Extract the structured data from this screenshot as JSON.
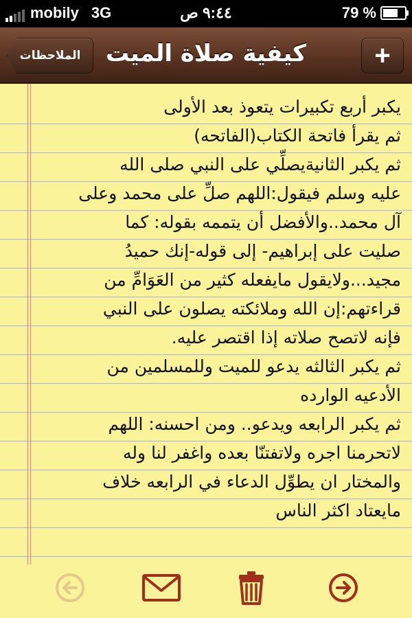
{
  "status_bar": {
    "carrier": "mobily",
    "network": "3G",
    "time": "٩:٤٤ ص",
    "battery": "79 %",
    "battery_level": 0.79
  },
  "nav": {
    "back_label": "الملاحظات",
    "title": "كيفية صلاة الميت",
    "add_label": "+"
  },
  "note": {
    "lines": [
      "يكبر أربع تكبيرات يتعوذ بعد الأولى",
      "ثم يقرأ فاتحة الكتاب(الفاتحه)",
      "ثم يكبر الثانيةيصلِّي على النبي صلى الله",
      "عليه وسلم فيقول:اللهم صلِّ على محمد وعلى",
      "آل محمد..والأفضل أن يتممه بقوله: كما",
      "صليت على إبراهيم- إلى قوله-إنك حميدُ",
      "مجيد...ولايقول مايفعله كثير من العَوَامِّ من",
      "قراءتهم:إن الله وملائكته يصلون على النبي",
      "فإنه لاتصح صلاته إذا اقتصر عليه.",
      "ثم يكبر الثالثه يدعو للميت وللمسلمين من",
      "الأدعيه الوارده",
      "ثم يكبر الرابعه ويدعو.. ومن احسنه: اللهم",
      "لاتحرمنا اجره ولاتفتنّا بعده واغفر لنا وله",
      "والمختار ان يطوِّل الدعاء في الرابعه خلاف",
      "مايعتاد اكثر الناس"
    ]
  },
  "toolbar": {
    "icons": [
      "back-arrow-icon",
      "mail-icon",
      "trash-icon",
      "forward-arrow-icon"
    ]
  },
  "colors": {
    "paper": "#fbf39a",
    "nav_leather": "#5a3322",
    "toolbar_icon": "#a0301c",
    "toolbar_icon_disabled": "#e3c98a"
  }
}
